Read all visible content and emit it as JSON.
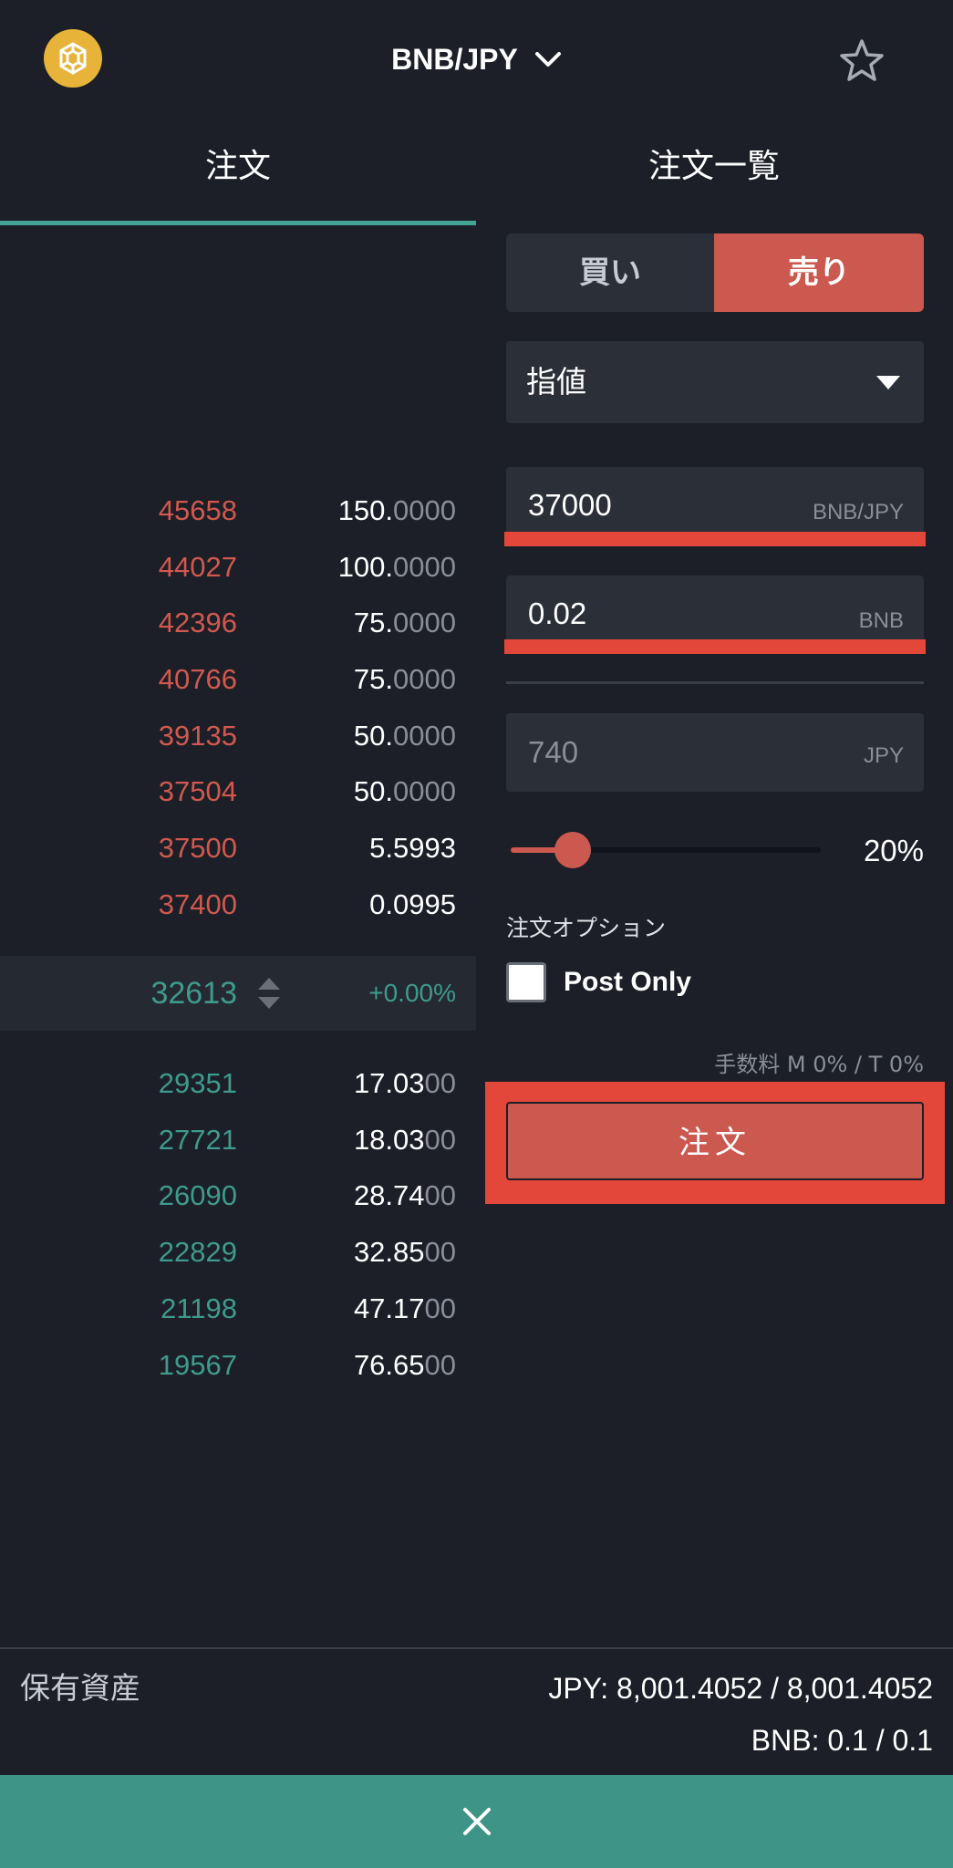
{
  "header": {
    "pair": "BNB/JPY"
  },
  "tabs": [
    {
      "label": "注文"
    },
    {
      "label": "注文一覧"
    }
  ],
  "orderbook": {
    "asks": [
      {
        "price": "45658",
        "amount_main": "150.",
        "amount_dim": "0000"
      },
      {
        "price": "44027",
        "amount_main": "100.",
        "amount_dim": "0000"
      },
      {
        "price": "42396",
        "amount_main": "75.",
        "amount_dim": "0000"
      },
      {
        "price": "40766",
        "amount_main": "75.",
        "amount_dim": "0000"
      },
      {
        "price": "39135",
        "amount_main": "50.",
        "amount_dim": "0000"
      },
      {
        "price": "37504",
        "amount_main": "50.",
        "amount_dim": "0000"
      },
      {
        "price": "37500",
        "amount_main": "5.5993",
        "amount_dim": ""
      },
      {
        "price": "37400",
        "amount_main": "0.0995",
        "amount_dim": ""
      }
    ],
    "mid": {
      "price": "32613",
      "change": "+0.00%"
    },
    "bids": [
      {
        "price": "29351",
        "amount_main": "17.03",
        "amount_dim": "00"
      },
      {
        "price": "27721",
        "amount_main": "18.03",
        "amount_dim": "00"
      },
      {
        "price": "26090",
        "amount_main": "28.74",
        "amount_dim": "00"
      },
      {
        "price": "22829",
        "amount_main": "32.85",
        "amount_dim": "00"
      },
      {
        "price": "21198",
        "amount_main": "47.17",
        "amount_dim": "00"
      },
      {
        "price": "19567",
        "amount_main": "76.65",
        "amount_dim": "00"
      }
    ]
  },
  "form": {
    "buy_label": "買い",
    "sell_label": "売り",
    "order_type": "指値",
    "price_value": "37000",
    "price_unit": "BNB/JPY",
    "qty_value": "0.02",
    "qty_unit": "BNB",
    "total_value": "740",
    "total_unit": "JPY",
    "slider_pct": "20%",
    "slider_fraction": 0.2,
    "options_label": "注文オプション",
    "post_only_label": "Post Only",
    "post_only_checked": false,
    "fee_text": "手数料 M 0% / T 0%",
    "submit_label": "注文"
  },
  "assets": {
    "label": "保有資産",
    "jpy": "JPY: 8,001.4052 / 8,001.4052",
    "bnb": "BNB: 0.1 / 0.1"
  },
  "colors": {
    "background": "#1c1f28",
    "sell_red": "#cc594f",
    "buy_green": "#3f9a8d",
    "highlight_red": "#e2473a",
    "bottom_bar": "#3e9486",
    "logo_yellow": "#e8b339"
  },
  "icons": {
    "logo": "bnb-logo-icon",
    "pair_dropdown": "chevron-down-icon",
    "favorite": "star-icon",
    "close": "close-icon"
  }
}
